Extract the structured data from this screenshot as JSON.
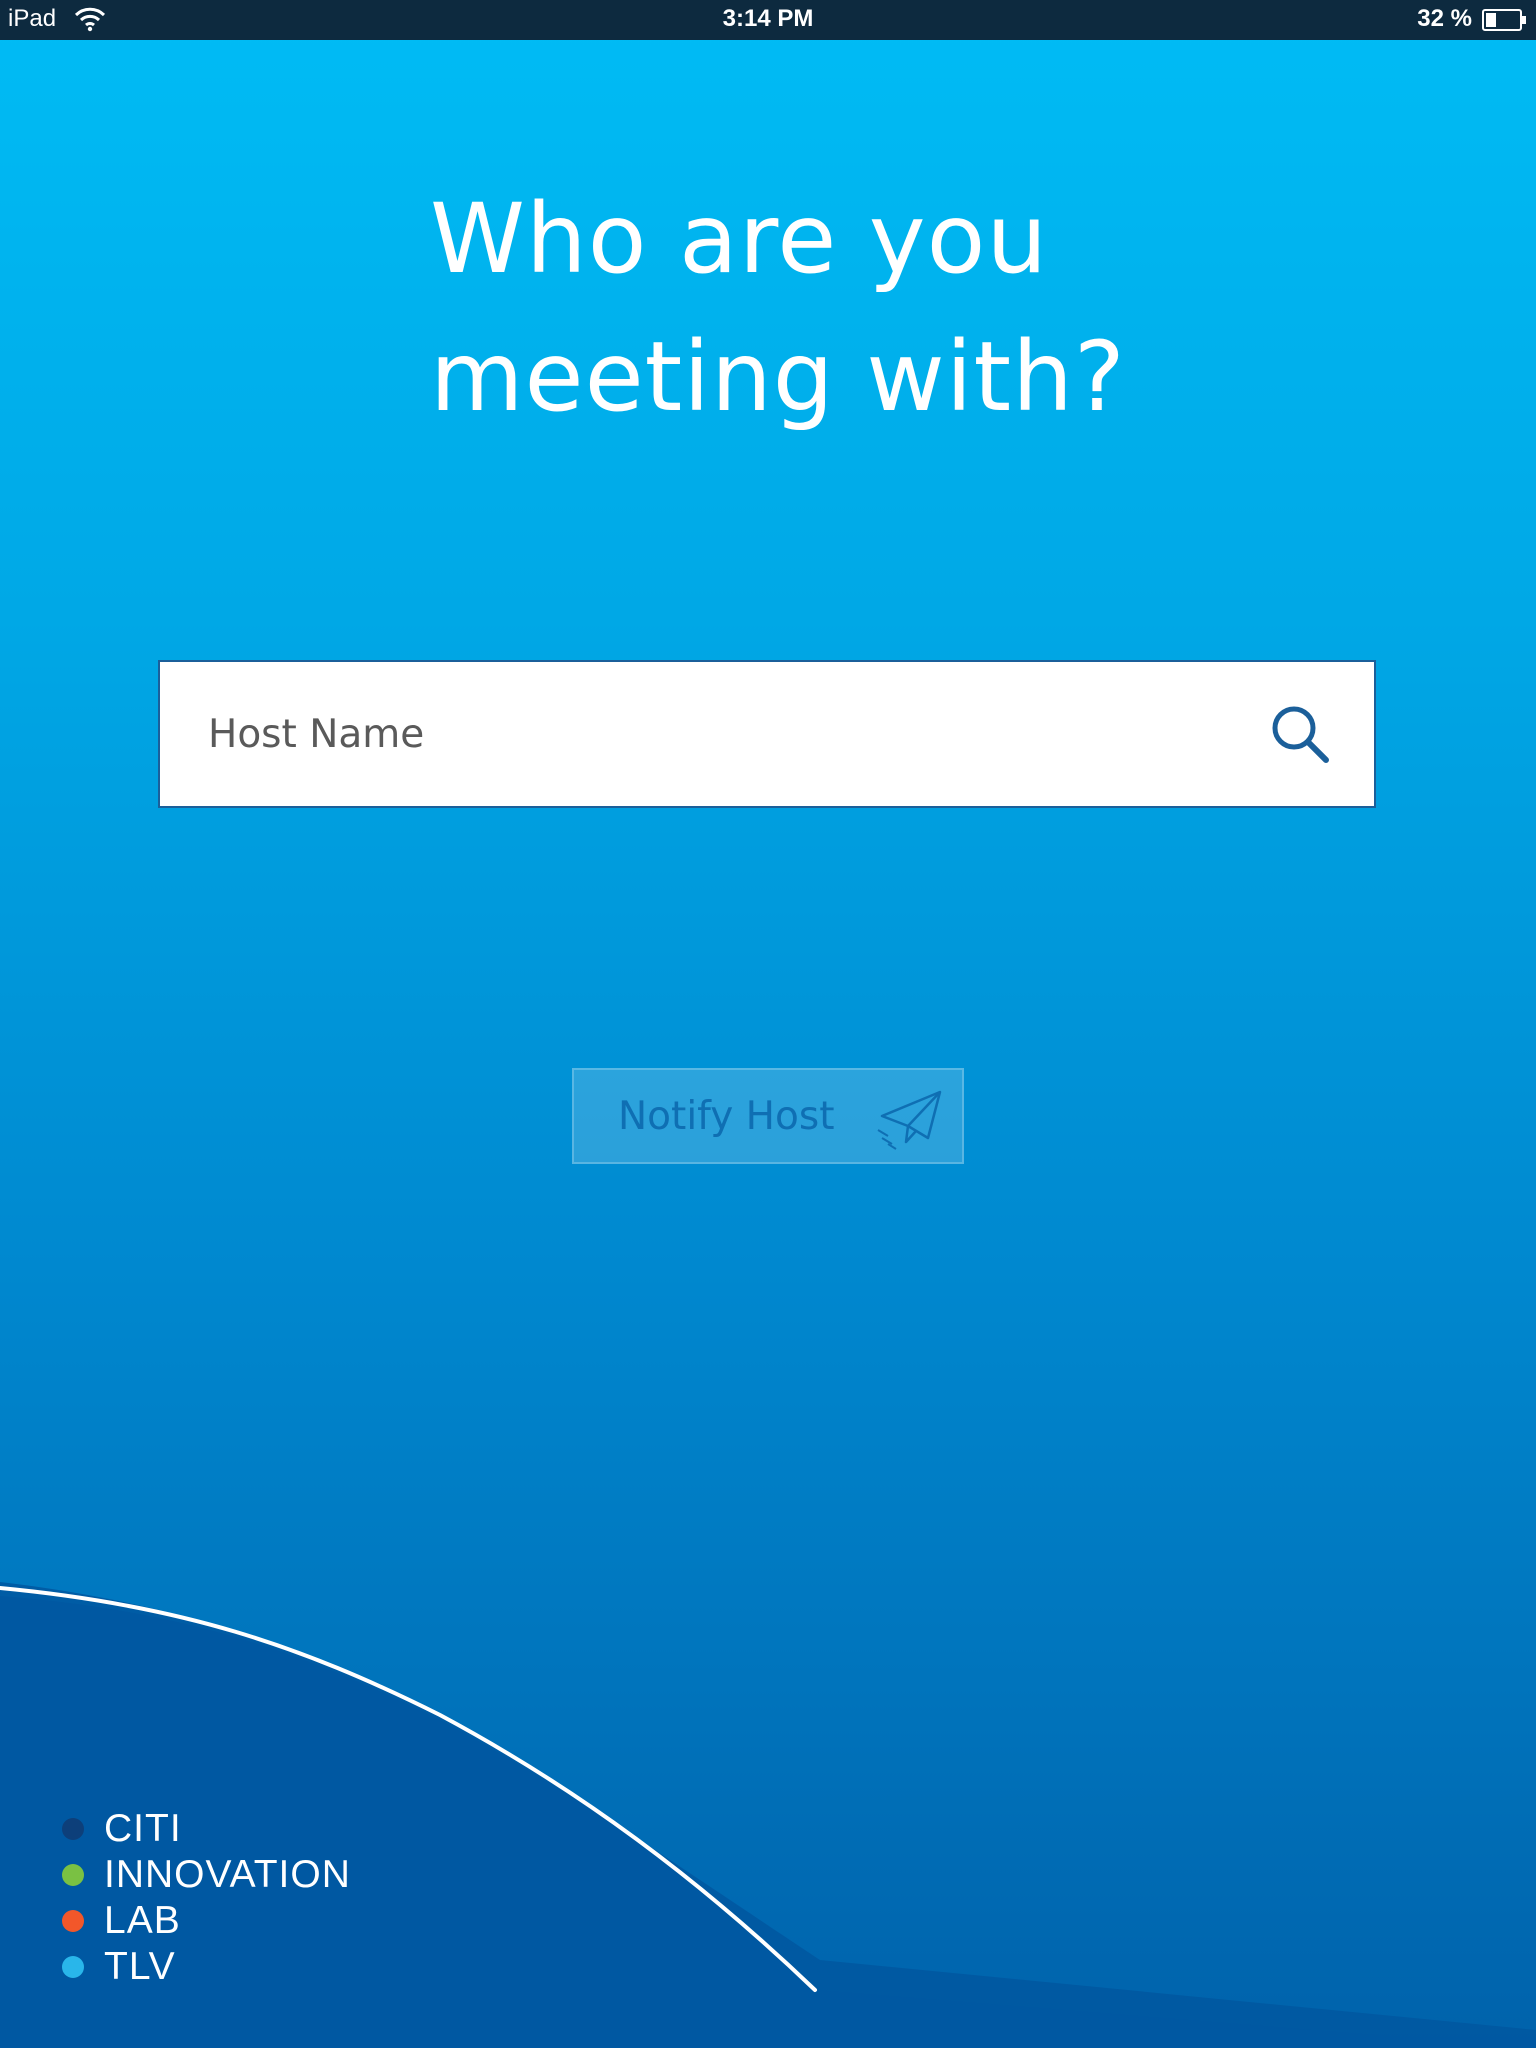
{
  "status_bar": {
    "device": "iPad",
    "time": "3:14 PM",
    "battery": "32 %",
    "icons": [
      "wifi-icon",
      "battery-icon"
    ]
  },
  "heading": {
    "line1": "Who are you",
    "line2": "meeting with?"
  },
  "search": {
    "placeholder": "Host Name",
    "value": "",
    "icon": "search-icon"
  },
  "notify_button": {
    "label": "Notify Host",
    "icon": "paper-plane-icon",
    "state": "disabled"
  },
  "logo": {
    "lines": [
      {
        "label": "CITI",
        "dot_color": "#0d3f7a"
      },
      {
        "label": "INNOVATION",
        "dot_color": "#7ac143"
      },
      {
        "label": "LAB",
        "dot_color": "#f2572a"
      },
      {
        "label": "TLV",
        "dot_color": "#29b6ea"
      }
    ]
  },
  "colors": {
    "background_top": "#00bcf5",
    "background_bottom": "#0062ab",
    "footer_wave": "#0057a0",
    "accent_blue": "#1b5f9a",
    "notify_text": "#0f6fb3"
  }
}
